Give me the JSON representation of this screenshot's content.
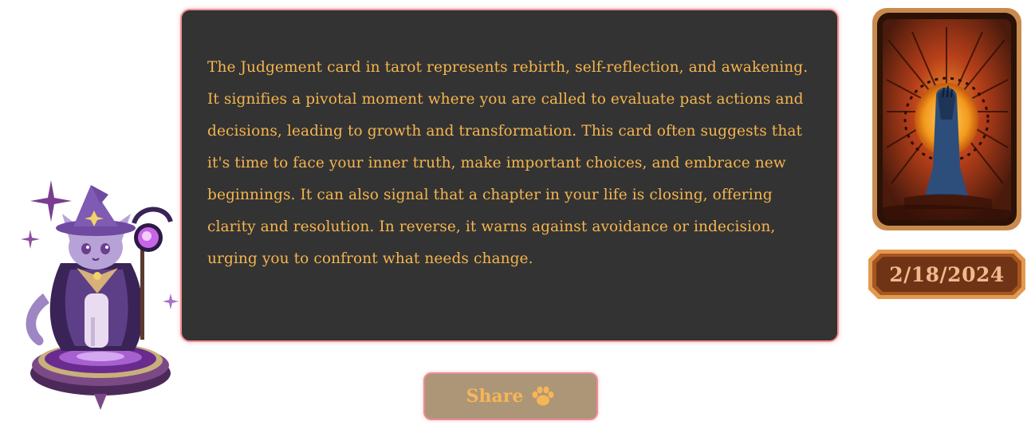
{
  "reading": {
    "text": "The Judgement card in tarot represents rebirth, self-reflection, and awakening. It signifies a pivotal moment where you are called to evaluate past actions and decisions, leading to growth and transformation. This card often suggests that it's time to face your inner truth, make important choices, and embrace new beginnings. It can also signal that a chapter in your life is closing, offering clarity and resolution. In reverse, it warns against avoidance or indecision, urging you to confront what needs change."
  },
  "share": {
    "label": "Share",
    "icon": "paw-icon"
  },
  "card": {
    "icon": "judgement-tarot-card"
  },
  "date": {
    "value": "2/18/2024"
  },
  "mascot": {
    "icon": "wizard-cat-mascot"
  },
  "colors": {
    "panel_bg": "#333333",
    "panel_border": "#f28f96",
    "text_accent": "#f5b54e",
    "button_bg": "#ad9578",
    "badge_bg": "#6e3415",
    "badge_border": "#d9873f"
  }
}
